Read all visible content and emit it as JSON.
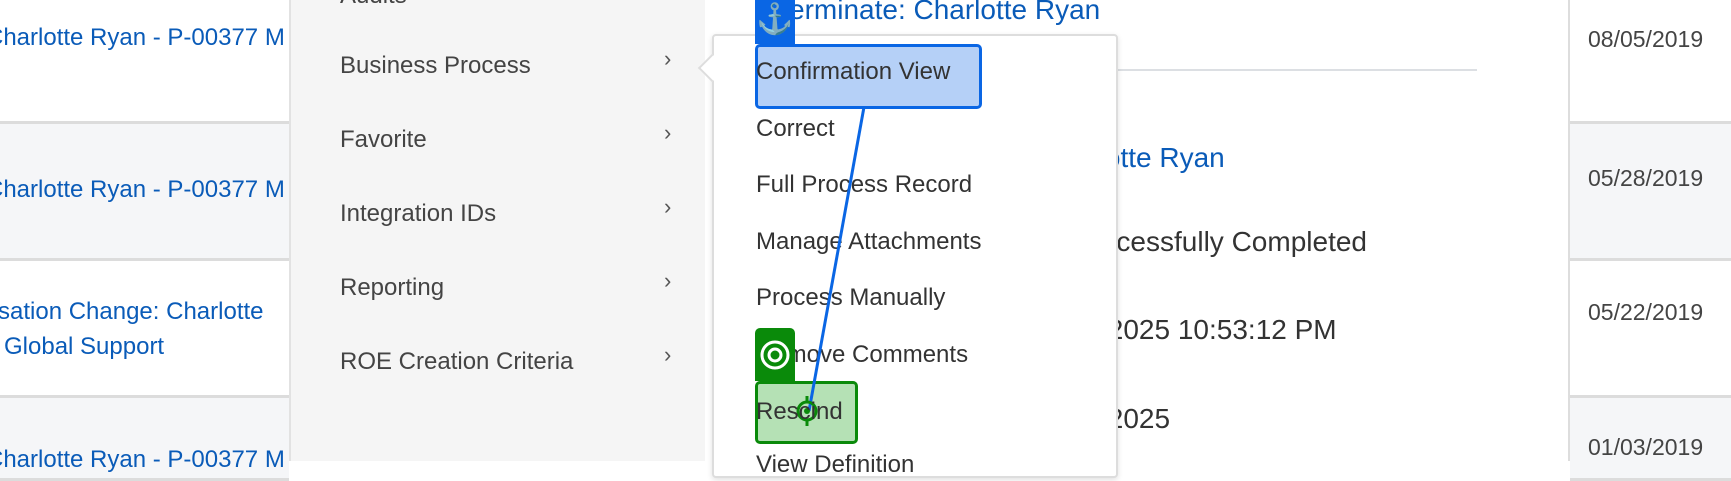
{
  "table_rows": [
    {
      "title": "Charlotte Ryan - P-00377 M",
      "date": "08/05/2019"
    },
    {
      "title": "Charlotte Ryan - P-00377 M",
      "date": "05/28/2019"
    },
    {
      "title": "sation Change: Charlotte",
      "title2": "Global Support",
      "date": "05/22/2019"
    },
    {
      "title": "Charlotte Ryan - P-00377 M",
      "date": "01/03/2019"
    }
  ],
  "menu": {
    "items": [
      {
        "label": "Audits"
      },
      {
        "label": "Business Process"
      },
      {
        "label": "Favorite"
      },
      {
        "label": "Integration IDs"
      },
      {
        "label": "Reporting"
      },
      {
        "label": "ROE Creation Criteria"
      }
    ]
  },
  "submenu": {
    "items": [
      {
        "label": "Confirmation View"
      },
      {
        "label": "Correct"
      },
      {
        "label": "Full Process Record"
      },
      {
        "label": "Manage Attachments"
      },
      {
        "label": "Process Manually"
      },
      {
        "label": "Remove Comments"
      },
      {
        "label": "Rescind"
      },
      {
        "label": "View Definition"
      }
    ]
  },
  "detail": {
    "title": "Terminate: Charlotte Ryan",
    "subject": "Charlotte Ryan",
    "status": "Successfully Completed",
    "completed": "/2025 10:53:12 PM",
    "effective": "/2025"
  },
  "overlay": {
    "source_color": "#0a66e4",
    "target_color": "#0a8a0a"
  }
}
